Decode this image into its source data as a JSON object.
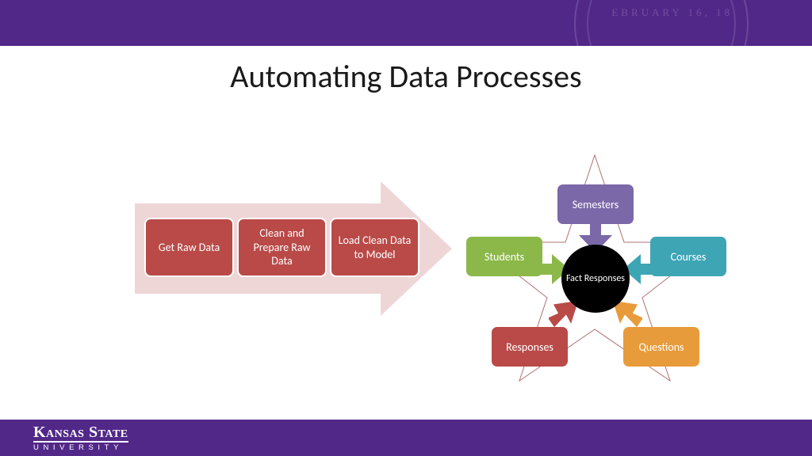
{
  "title": "Automating Data Processes",
  "process": {
    "step1": "Get Raw Data",
    "step2": "Clean and Prepare Raw Data",
    "step3": "Load Clean Data to Model"
  },
  "star": {
    "center": "Fact Responses",
    "top": "Semesters",
    "left": "Students",
    "right": "Courses",
    "bottom_left": "Responses",
    "bottom_right": "Questions"
  },
  "footer": {
    "name": "Kansas State",
    "sub": "UNIVERSITY"
  },
  "seal_text": "EBRUARY 16, 18",
  "colors": {
    "brand_purple": "#512888",
    "proc_red": "#b94a48",
    "dim_purple": "#7b68a8",
    "dim_green": "#8cb84a",
    "dim_teal": "#3ea5b5",
    "dim_red": "#b94a48",
    "dim_orange": "#e89b3a"
  }
}
